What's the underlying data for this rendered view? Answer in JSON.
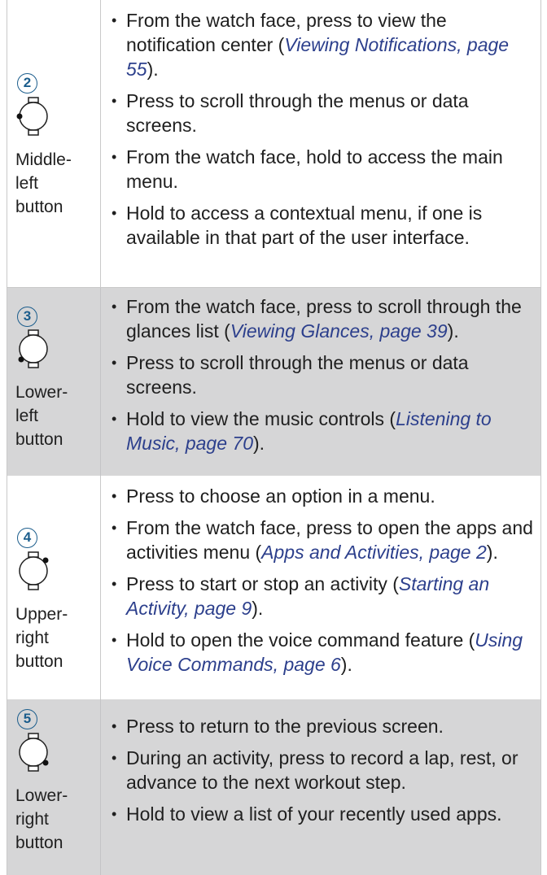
{
  "rows": [
    {
      "number": "2",
      "label_lines": [
        "Middle-",
        "left",
        "button"
      ],
      "bullets": [
        {
          "pre": "From the watch face, press to view the notification center (",
          "link": "Viewing Notifications, page 55",
          "post": ")."
        },
        {
          "pre": "Press to scroll through the menus or data screens.",
          "link": "",
          "post": ""
        },
        {
          "pre": "From the watch face, hold to access the main menu.",
          "link": "",
          "post": ""
        },
        {
          "pre": "Hold to access a contextual menu, if one is available in that part of the user interface.",
          "link": "",
          "post": ""
        }
      ]
    },
    {
      "number": "3",
      "label_lines": [
        "Lower-",
        "left",
        "button"
      ],
      "bullets": [
        {
          "pre": "From the watch face, press to scroll through the glances list (",
          "link": "Viewing Glances, page 39",
          "post": ")."
        },
        {
          "pre": "Press to scroll through the menus or data screens.",
          "link": "",
          "post": ""
        },
        {
          "pre": "Hold to view the music controls (",
          "link": "Listening to Music, page 70",
          "post": ")."
        }
      ]
    },
    {
      "number": "4",
      "label_lines": [
        "Upper-",
        "right",
        "button"
      ],
      "bullets": [
        {
          "pre": "Press to choose an option in a menu.",
          "link": "",
          "post": ""
        },
        {
          "pre": "From the watch face, press to open the apps and activities menu (",
          "link": "Apps and Activities, page 2",
          "post": ")."
        },
        {
          "pre": "Press to start or stop an activity (",
          "link": "Starting an Activity, page 9",
          "post": ")."
        },
        {
          "pre": "Hold to open the voice command feature (",
          "link": "Using Voice Commands, page 6",
          "post": ")."
        }
      ]
    },
    {
      "number": "5",
      "label_lines": [
        "Lower-",
        "right",
        "button"
      ],
      "bullets": [
        {
          "pre": "Press to return to the previous screen.",
          "link": "",
          "post": ""
        },
        {
          "pre": "During an activity, press to record a lap, rest, or advance to the next workout step.",
          "link": "",
          "post": ""
        },
        {
          "pre": "Hold to view a list of your recently used apps.",
          "link": "",
          "post": ""
        }
      ]
    }
  ],
  "colors": {
    "number_accent": "#1b5d8c",
    "link": "#2c3f8c",
    "shade": "#d6d6d7"
  }
}
